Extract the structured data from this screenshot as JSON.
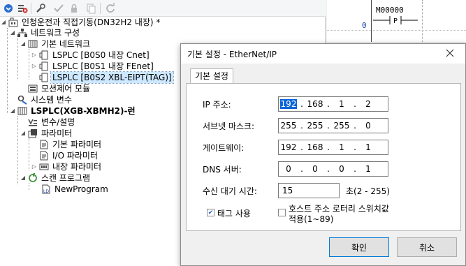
{
  "tree": {
    "root": "인청운전과 직접기동(DN32H2 내장) *",
    "network_config": "네트워크 구성",
    "basic_network": "기본 네트워크",
    "plc_cnet": "LSPLC [B0S0 내장 Cnet]",
    "plc_fenet": "LSPLC [B0S1 내장 FEnet]",
    "plc_eip": "LSPLC [B0S2 XBL-EIPT(TAG)]",
    "motion_module": "모션제어 모듈",
    "system_vars": "시스템 변수",
    "plc_main": "LSPLC(XGB-XBMH2)-런",
    "var_desc": "변수/설명",
    "params": "파라미터",
    "basic_params": "기본 파라미터",
    "io_params": "I/O 파라미터",
    "builtin_params": "내장 파라미터",
    "scan_program": "스캔 프로그램",
    "new_program": "NewProgram"
  },
  "ladder": {
    "rung_number": "0",
    "contact_name": "M00000",
    "contact_symbol": "-|P|-"
  },
  "dialog": {
    "title": "기본 설정 - EtherNet/IP",
    "tab": "기본 설정",
    "ip_label": "IP 주소:",
    "ip": [
      "192",
      "168",
      "1",
      "2"
    ],
    "subnet_label": "서브넷 마스크:",
    "subnet": [
      "255",
      "255",
      "255",
      "0"
    ],
    "gateway_label": "게이트웨이:",
    "gateway": [
      "192",
      "168",
      "1",
      "1"
    ],
    "dns_label": "DNS 서버:",
    "dns": [
      "0",
      "0",
      "0",
      "1"
    ],
    "timeout_label": "수신 대기 시간:",
    "timeout_value": "15",
    "timeout_range": "초(2 - 255)",
    "tag_use_label": "태그 사용",
    "tag_use_checked": true,
    "host_switch_label_1": "호스트 주소 로터리 스위치값",
    "host_switch_label_2": "적용(1~89)",
    "host_switch_checked": false,
    "ok": "확인",
    "cancel": "취소"
  },
  "colors": {
    "accent": "#0078d7",
    "selection": "#0a64d8",
    "tree_selected": "#cde8ff"
  }
}
